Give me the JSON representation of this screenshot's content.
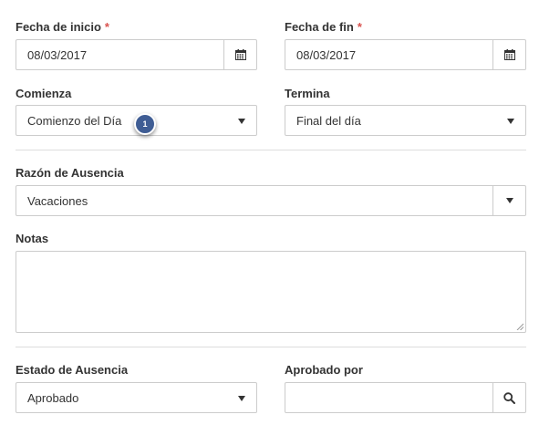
{
  "form": {
    "start_date": {
      "label": "Fecha de inicio",
      "required_mark": "*",
      "value": "08/03/2017",
      "icon": "calendar-icon"
    },
    "end_date": {
      "label": "Fecha de fin",
      "required_mark": "*",
      "value": "08/03/2017",
      "icon": "calendar-icon"
    },
    "begins": {
      "label": "Comienza",
      "selected": "Comienzo del Día"
    },
    "ends": {
      "label": "Termina",
      "selected": "Final del día"
    },
    "absence_reason": {
      "label": "Razón de Ausencia",
      "selected": "Vacaciones"
    },
    "notes": {
      "label": "Notas",
      "value": ""
    },
    "absence_status": {
      "label": "Estado de Ausencia",
      "selected": "Aprobado"
    },
    "approved_by": {
      "label": "Aprobado por",
      "value": "",
      "icon": "search-icon"
    }
  },
  "annotation": {
    "step": "1",
    "color": "#3f5d94"
  },
  "colors": {
    "required": "#d9534f",
    "border": "#cccccc",
    "divider": "#dddddd",
    "text": "#333333"
  }
}
